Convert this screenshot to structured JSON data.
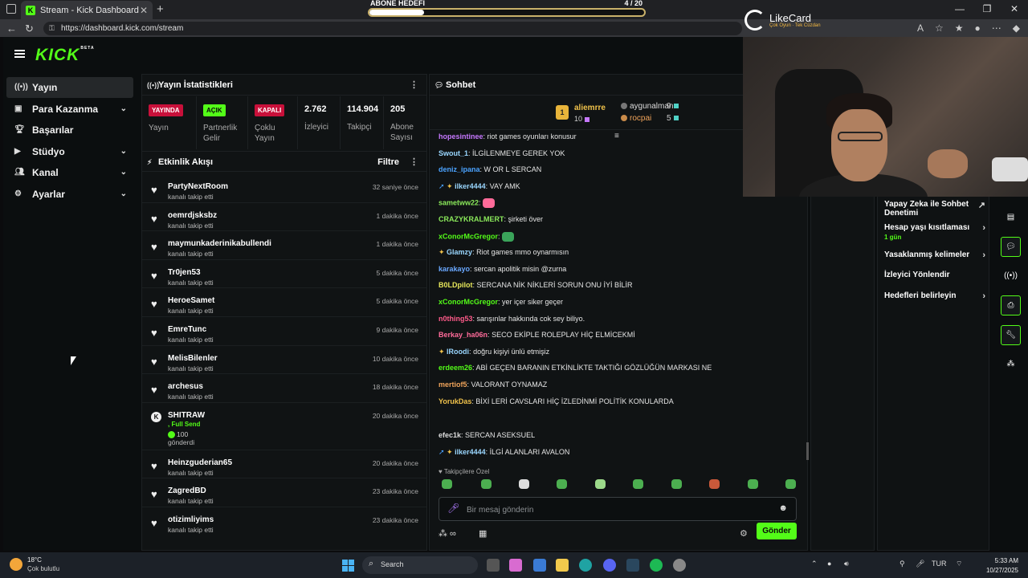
{
  "browser": {
    "tab_title": "Stream - Kick Dashboard",
    "url": "https://dashboard.kick.com/stream"
  },
  "goal": {
    "title": "ABONE HEDEFİ",
    "current": 4,
    "target": 20,
    "count_label": "4  / 20"
  },
  "brand": {
    "logo": "KICK",
    "beta": "BETA",
    "accent": "#53fc18"
  },
  "sidebar": {
    "items": [
      {
        "label": "Yayın",
        "icon": "broadcast-icon",
        "active": true
      },
      {
        "label": "Para Kazanma",
        "icon": "wallet-icon",
        "expandable": true
      },
      {
        "label": "Başarılar",
        "icon": "trophy-icon"
      },
      {
        "label": "Stüdyo",
        "icon": "studio-icon",
        "expandable": true
      },
      {
        "label": "Kanal",
        "icon": "users-icon",
        "expandable": true
      },
      {
        "label": "Ayarlar",
        "icon": "gear-icon",
        "expandable": true
      }
    ]
  },
  "stats": {
    "title": "Yayın İstatistikleri",
    "items": [
      {
        "badge": "YAYINDA",
        "label": "Yayın"
      },
      {
        "badge": "AÇIK",
        "label": "Partnerlik Gelir"
      },
      {
        "badge": "KAPALI",
        "label": "Çoklu Yayın"
      },
      {
        "value": "2.762",
        "label": "İzleyici"
      },
      {
        "value": "114.904",
        "label": "Takipçi"
      },
      {
        "value": "205",
        "label": "Abone Sayısı"
      }
    ]
  },
  "activity": {
    "title": "Etkinlik Akışı",
    "filter_label": "Filtre",
    "follow_text": "kanalı takip etti",
    "items": [
      {
        "name": "PartyNextRoom",
        "time": "32 saniye önce"
      },
      {
        "name": "oemrdjsksbz",
        "time": "1 dakika önce"
      },
      {
        "name": "maymunkaderinikabullendi",
        "time": "1 dakika önce"
      },
      {
        "name": "Tr0jen53",
        "time": "5 dakika önce"
      },
      {
        "name": "HeroeSamet",
        "time": "5 dakika önce"
      },
      {
        "name": "EmreTunc",
        "time": "9 dakika önce"
      },
      {
        "name": "MelisBilenler",
        "time": "10 dakika önce"
      },
      {
        "name": "archesus",
        "time": "18 dakika önce"
      },
      {
        "name": "SHITRAW",
        "time": "20 dakika önce",
        "kicks": true,
        "sub_label": ", Full Send",
        "amount": "100",
        "sent": "gönderdi"
      },
      {
        "name": "Heinzguderian65",
        "time": "20 dakika önce"
      },
      {
        "name": "ZagredBD",
        "time": "23 dakika önce"
      },
      {
        "name": "otizimliyims",
        "time": "23 dakika önce"
      }
    ]
  },
  "chat": {
    "title": "Sohbet",
    "leaders": {
      "first": {
        "rank": "1",
        "name": "aliemrre",
        "count": "10"
      },
      "second": {
        "name": "aygunalman",
        "count": "9"
      },
      "third": {
        "name": "rocpai",
        "count": "5"
      }
    },
    "messages": [
      {
        "user": "hopesintinee",
        "color": "#c678ff",
        "text": "riot games oyunları konusur"
      },
      {
        "user": "Swout_1",
        "color": "#9ad7ff",
        "text": "İLGİLENMEYE GEREK YOK"
      },
      {
        "user": "deniz_ipana",
        "color": "#4ba3ff",
        "text": "W OR L SERCAN"
      },
      {
        "user": "ilker4444",
        "color": "#9ad7ff",
        "text": "VAY AMK",
        "badges": true
      },
      {
        "user": "sametww22",
        "color": "#8bea5b",
        "text": "",
        "sticker": true
      },
      {
        "user": "CRAZYKRALMERT",
        "color": "#8bea5b",
        "text": "şirketi över"
      },
      {
        "user": "xConorMcGregor",
        "color": "#53fc18",
        "text": "",
        "sticker": true
      },
      {
        "user": "Glamzy",
        "color": "#9ad7ff",
        "text": "Riot games mmo oynarmısın",
        "badges": true
      },
      {
        "user": "karakayo",
        "color": "#6aa8ff",
        "text": "sercan apolitik misin @zurna"
      },
      {
        "user": "B0LDpilot",
        "color": "#e6e65a",
        "text": "SERCANA NİK NİKLERİ SORUN ONU İYİ BİLİR"
      },
      {
        "user": "xConorMcGregor",
        "color": "#53fc18",
        "text": "yer içer siker geçer"
      },
      {
        "user": "n0thing53",
        "color": "#ff5b8a",
        "text": "sarışınlar hakkında cok sey biliyo."
      },
      {
        "user": "Berkay_ha06n",
        "color": "#ff6b9a",
        "text": "SECO EKİPLE ROLEPLAY HİÇ ELMİCEKMİ"
      },
      {
        "user": "lRoodi",
        "color": "#9ad7ff",
        "text": "doğru kişiyi ünlü etmişiz",
        "badges": true
      },
      {
        "user": "erdeem26",
        "color": "#53fc18",
        "text": "ABİ GEÇEN BARANIN ETKİNLİKTE TAKTIĞI GÖZLÜĞÜN MARKASI NE"
      },
      {
        "user": "mertiof5",
        "color": "#f0a45b",
        "text": "VALORANT OYNAMAZ"
      },
      {
        "user": "YorukDas",
        "color": "#f0c24b",
        "text": "BİXİ LERİ CAVSLARI HİÇ İZLEDİNMİ POLİTİK KONULARDA"
      },
      {
        "user": "efec1k",
        "color": "#dddddd",
        "text": "SERCAN ASEKSUEL"
      },
      {
        "user": "ilker4444",
        "color": "#9ad7ff",
        "text": "İLGİ ALANLARI AVALON",
        "badges": true
      }
    ],
    "followers_only": "Takipçilere Özel",
    "input_placeholder": "Bir mesaj gönderin",
    "send_label": "Gönder"
  },
  "settings": {
    "items": [
      {
        "label": "Yapay Zeka ile Sohbet Denetimi",
        "arrow": "↗"
      },
      {
        "label": "Hesap yaşı kısıtlaması",
        "sub": "1 gün",
        "arrow": "›"
      },
      {
        "label": "Yasaklanmış kelimeler",
        "arrow": "›"
      },
      {
        "label": "İzleyici Yönlendir",
        "arrow": ""
      },
      {
        "label": "Hedefleri belirleyin",
        "arrow": "›"
      }
    ]
  },
  "overlay": {
    "sponsor": "LikeCard",
    "sponsor_sub": "Çok Oyun · Tek Cüzdan"
  },
  "taskbar": {
    "weather_temp": "18°C",
    "weather_desc": "Çok bulutlu",
    "search": "Search",
    "lang": "TUR",
    "time": "5:33 AM",
    "date": "10/27/2025"
  }
}
